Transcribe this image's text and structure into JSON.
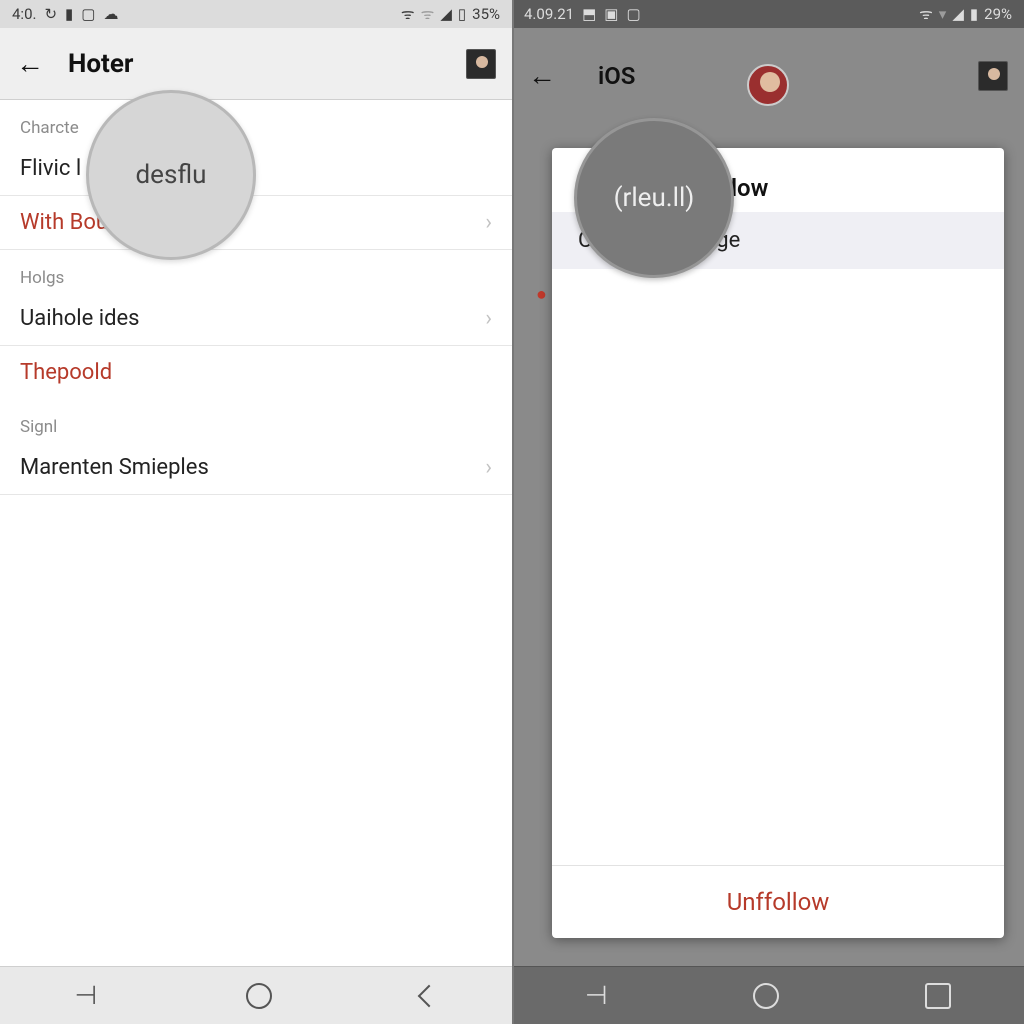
{
  "left": {
    "statusbar": {
      "time": "4:0.",
      "battery": "35%"
    },
    "appbar": {
      "title": "Hoter"
    },
    "lens_text": "desflu",
    "sections": [
      {
        "label": "Charcte",
        "item": "Flivic l",
        "red": false,
        "chevron": false
      },
      {
        "label": "",
        "item": "With Bout",
        "red": true,
        "chevron": true
      },
      {
        "label": "Holgs",
        "item": "Uaihole ides",
        "red": false,
        "chevron": true
      },
      {
        "label": "",
        "item": "Thepoold",
        "red": true,
        "chevron": false
      },
      {
        "label": "Signl",
        "item": "Marenten Smieples",
        "red": false,
        "chevron": true
      }
    ]
  },
  "right": {
    "statusbar": {
      "time": "4.09.21",
      "battery": "29%"
    },
    "appbar": {
      "title": "iOS",
      "subname": ""
    },
    "lens_text": "(rleu.ll)",
    "sheet": {
      "header_prefix": "P",
      "header_suffix": "follow",
      "row_prefix": "C",
      "row_suffix": "Page",
      "footer": "Unffollow"
    }
  }
}
